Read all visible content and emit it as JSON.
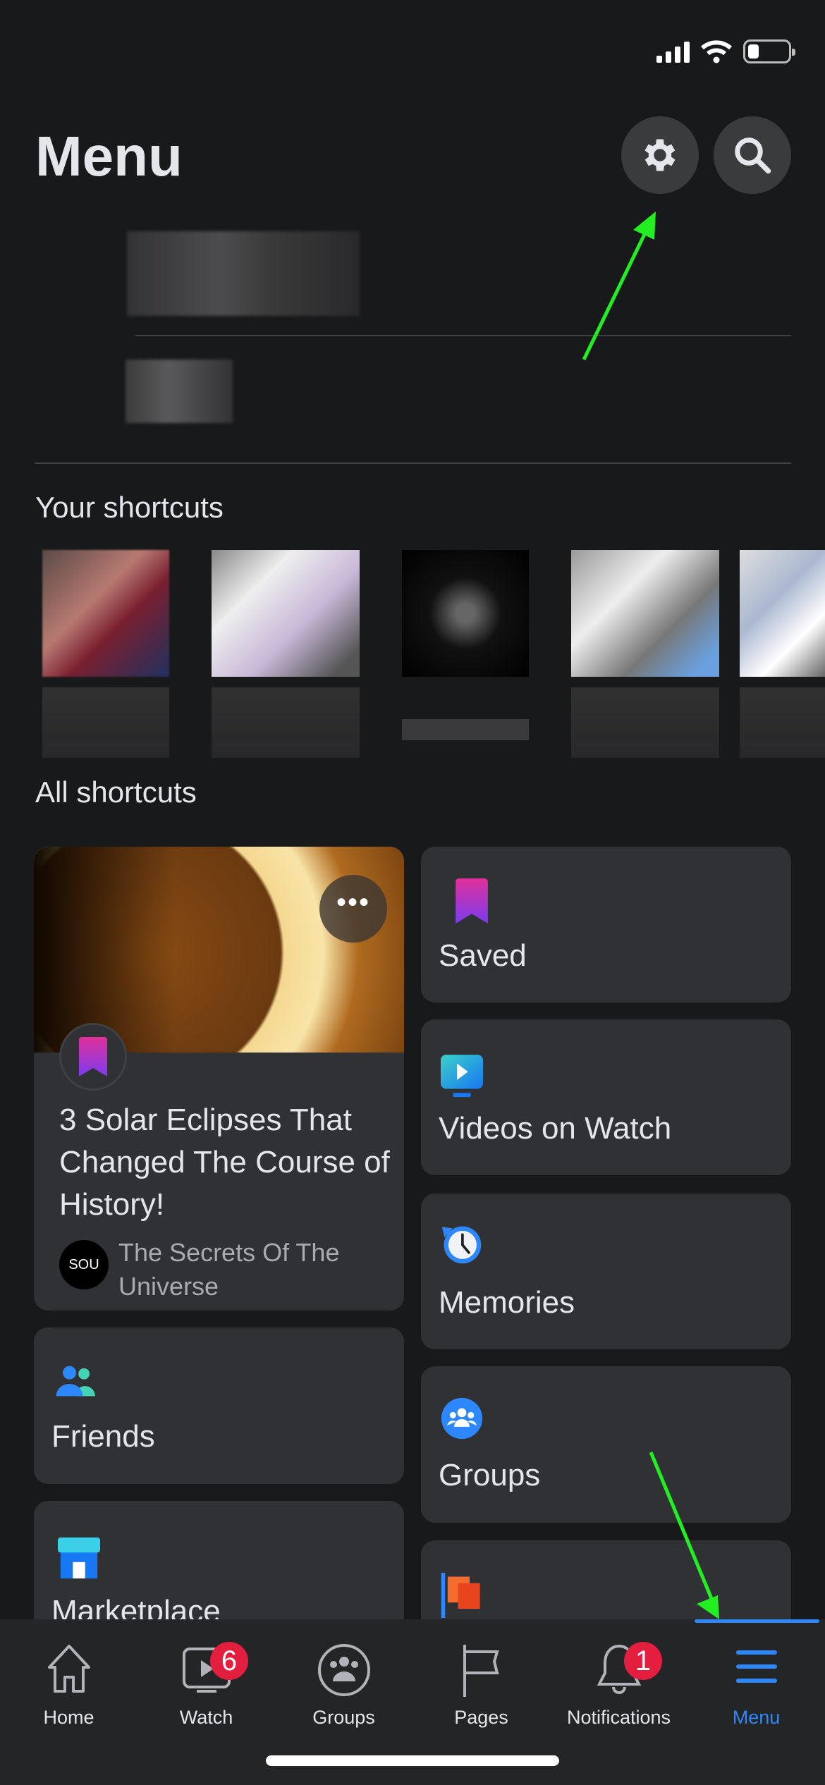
{
  "status_bar": {
    "battery_level": 0.28
  },
  "header": {
    "title": "Menu",
    "settings_icon": "gear-icon",
    "search_icon": "search-icon"
  },
  "sections": {
    "your_shortcuts": "Your shortcuts",
    "all_shortcuts": "All shortcuts"
  },
  "article_card": {
    "title": "3 Solar Eclipses That Changed The Course of History!",
    "source": "The Secrets Of The Universe",
    "source_logo": "SOU"
  },
  "shortcuts": {
    "saved": "Saved",
    "videos_on_watch": "Videos on Watch",
    "memories": "Memories",
    "friends": "Friends",
    "groups": "Groups",
    "marketplace": "Marketplace"
  },
  "tabbar": {
    "home": "Home",
    "watch": "Watch",
    "watch_badge": "6",
    "groups": "Groups",
    "pages": "Pages",
    "notifications": "Notifications",
    "notifications_badge": "1",
    "menu": "Menu"
  },
  "colors": {
    "accent": "#2d88ff",
    "badge": "#e41e3f",
    "annotation_arrow": "#22ee22",
    "background": "#18191a",
    "card": "#242526"
  }
}
